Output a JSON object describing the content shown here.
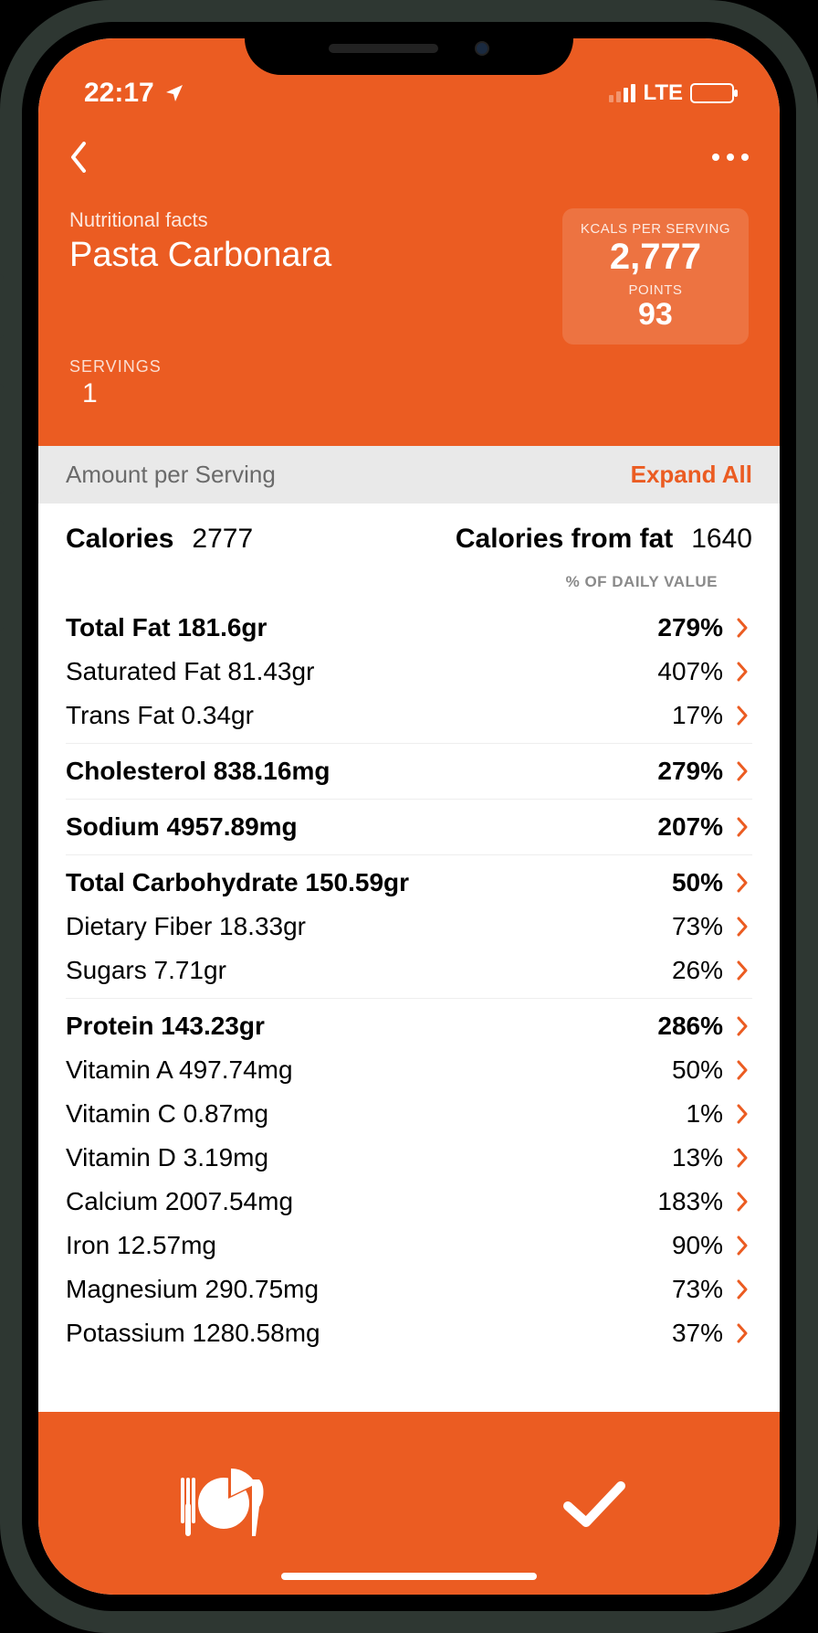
{
  "status": {
    "time": "22:17",
    "network": "LTE"
  },
  "header": {
    "subtitle": "Nutritional facts",
    "title": "Pasta Carbonara",
    "kcals_label": "KCALS PER SERVING",
    "kcals_value": "2,777",
    "points_label": "POINTS",
    "points_value": "93",
    "servings_label": "SERVINGS",
    "servings_value": "1"
  },
  "section": {
    "amount_label": "Amount per Serving",
    "expand_label": "Expand All"
  },
  "calories": {
    "label": "Calories",
    "value": "2777",
    "from_fat_label": "Calories from fat",
    "from_fat_value": "1640"
  },
  "dv_label": "% OF DAILY VALUE",
  "groups": [
    {
      "rows": [
        {
          "name": "Total Fat 181.6gr",
          "pct": "279%",
          "bold": true
        },
        {
          "name": "Saturated Fat 81.43gr",
          "pct": "407%",
          "bold": false
        },
        {
          "name": "Trans Fat 0.34gr",
          "pct": "17%",
          "bold": false
        }
      ]
    },
    {
      "rows": [
        {
          "name": "Cholesterol 838.16mg",
          "pct": "279%",
          "bold": true
        }
      ]
    },
    {
      "rows": [
        {
          "name": "Sodium 4957.89mg",
          "pct": "207%",
          "bold": true
        }
      ]
    },
    {
      "rows": [
        {
          "name": "Total Carbohydrate 150.59gr",
          "pct": "50%",
          "bold": true
        },
        {
          "name": "Dietary Fiber 18.33gr",
          "pct": "73%",
          "bold": false
        },
        {
          "name": "Sugars 7.71gr",
          "pct": "26%",
          "bold": false
        }
      ]
    },
    {
      "rows": [
        {
          "name": "Protein 143.23gr",
          "pct": "286%",
          "bold": true
        },
        {
          "name": "Vitamin A 497.74mg",
          "pct": "50%",
          "bold": false
        },
        {
          "name": "Vitamin C 0.87mg",
          "pct": "1%",
          "bold": false
        },
        {
          "name": "Vitamin D 3.19mg",
          "pct": "13%",
          "bold": false
        },
        {
          "name": "Calcium 2007.54mg",
          "pct": "183%",
          "bold": false
        },
        {
          "name": "Iron 12.57mg",
          "pct": "90%",
          "bold": false
        },
        {
          "name": "Magnesium 290.75mg",
          "pct": "73%",
          "bold": false
        },
        {
          "name": "Potassium 1280.58mg",
          "pct": "37%",
          "bold": false
        }
      ]
    }
  ]
}
